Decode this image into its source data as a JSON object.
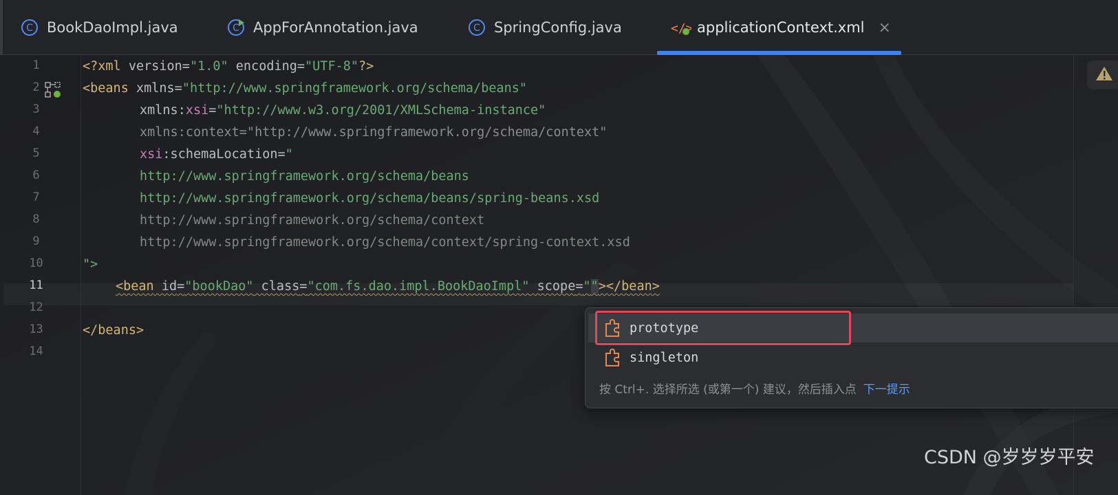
{
  "tabs": [
    {
      "label": "BookDaoImpl.java",
      "icon": "java-class-icon"
    },
    {
      "label": "AppForAnnotation.java",
      "icon": "java-class-run-icon"
    },
    {
      "label": "SpringConfig.java",
      "icon": "java-class-icon"
    },
    {
      "label": "applicationContext.xml",
      "icon": "xml-spring-icon",
      "active": true
    }
  ],
  "close_glyph": "×",
  "line_numbers": [
    "1",
    "2",
    "3",
    "4",
    "5",
    "6",
    "7",
    "8",
    "9",
    "10",
    "11",
    "12",
    "13",
    "14"
  ],
  "current_line": "11",
  "code": {
    "l1": {
      "a": "<?xml ",
      "b": "version",
      "c": "=",
      "d": "\"1.0\"",
      "e": " encoding",
      "f": "=",
      "g": "\"UTF-8\"",
      "h": "?>"
    },
    "l2": {
      "a": "<beans ",
      "b": "xmlns",
      "c": "=",
      "d": "\"http://www.springframework.org/schema/beans\""
    },
    "l3": {
      "a": "xmlns:",
      "b": "xsi",
      "c": "=",
      "d": "\"http://www.w3.org/2001/XMLSchema-instance\""
    },
    "l4": {
      "a": "xmlns:context=\"http://www.springframework.org/schema/context\""
    },
    "l5": {
      "a": "xsi",
      "b": ":schemaLocation=",
      "c": "\""
    },
    "l6": {
      "a": "http://www.springframework.org/schema/beans"
    },
    "l7": {
      "a": "http://www.springframework.org/schema/beans/spring-beans.xsd"
    },
    "l8": {
      "a": "http://www.springframework.org/schema/context"
    },
    "l9": {
      "a": "http://www.springframework.org/schema/context/spring-context.xsd"
    },
    "l10": {
      "a": "\">"
    },
    "l11": {
      "a": "<bean",
      "b": " id",
      "c": "=",
      "d": "\"bookDao\"",
      "e": " class",
      "f": "=",
      "g": "\"com.fs.dao.impl.BookDaoImpl\"",
      "h": " scope",
      "i": "=",
      "j": "\"",
      "k": "\"",
      "l": "></bean>"
    },
    "l13": {
      "a": "</beans>"
    }
  },
  "completion": {
    "items": [
      "prototype",
      "singleton"
    ],
    "footer_text": "按 Ctrl+. 选择所选 (或第一个) 建议，然后插入点",
    "footer_link": "下一提示",
    "more_glyph": "⋮"
  },
  "watermark": "CSDN @岁岁岁平安",
  "colors": {
    "accent": "#3b82f6",
    "tag": "#d5b778",
    "string": "#6aab73",
    "namespace": "#c77dbb",
    "highlight_outline": "#e5485b"
  }
}
